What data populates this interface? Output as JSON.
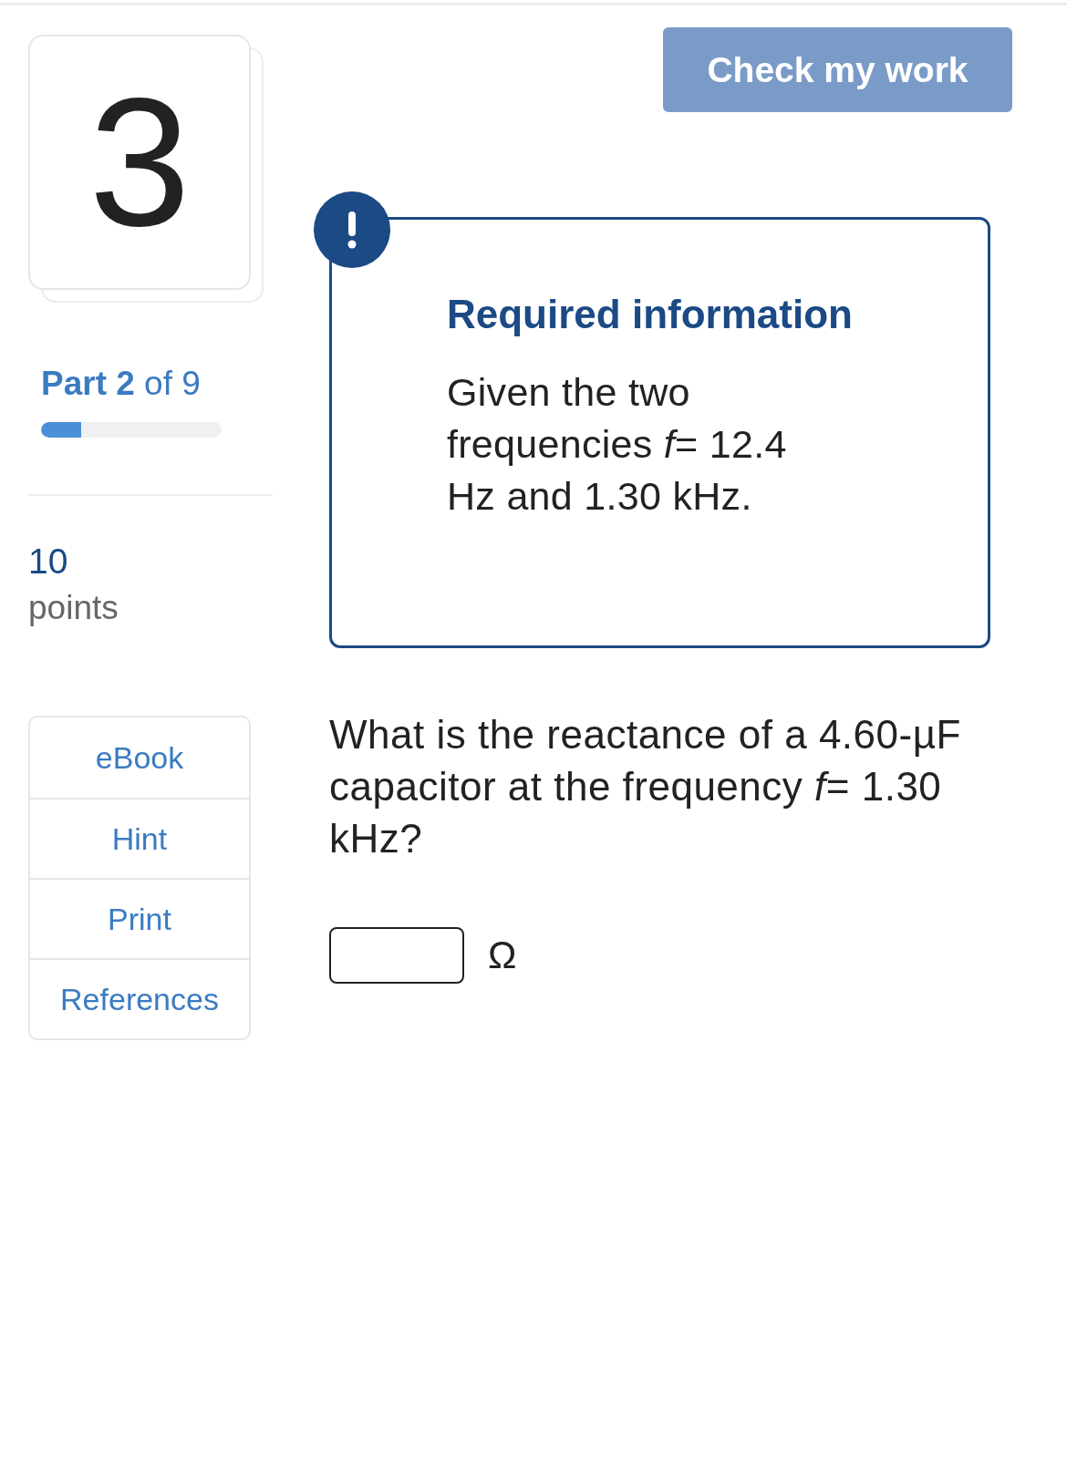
{
  "question_number": "3",
  "check_button": {
    "label": "Check my work",
    "disabled": true
  },
  "part_progress": {
    "text": "**Part 2** of 9",
    "level": 0.222
  },
  "points": {
    "value": "10",
    "label": "points"
  },
  "resources": [
    {
      "label": "eBook"
    },
    {
      "label": "Hint"
    },
    {
      "label": "Print"
    },
    {
      "label": "References"
    }
  ],
  "required_info": {
    "title": "Required information",
    "text": "Given the two frequencies *f*= 12.4 Hz and 1.30 kHz."
  },
  "question": {
    "text": "What is the reactance of a 4.60-µF capacitor at the frequency *f*= 1.30 kHz?",
    "unit": "Ω"
  }
}
